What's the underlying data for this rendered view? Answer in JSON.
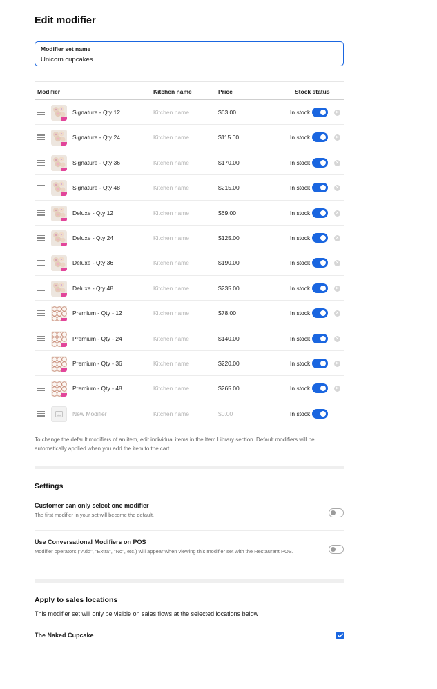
{
  "page": {
    "title": "Edit modifier"
  },
  "name_field": {
    "label": "Modifier set name",
    "value": "Unicorn cupcakes"
  },
  "table": {
    "headers": {
      "modifier": "Modifier",
      "kitchen": "Kitchen name",
      "price": "Price",
      "stock": "Stock status"
    },
    "kitchen_placeholder": "Kitchen name",
    "rows": [
      {
        "name": "Signature - Qty 12",
        "price": "$63.00",
        "stock": "In stock",
        "image": "cupcake-photo"
      },
      {
        "name": "Signature - Qty 24",
        "price": "$115.00",
        "stock": "In stock",
        "image": "cupcake-photo"
      },
      {
        "name": "Signature - Qty 36",
        "price": "$170.00",
        "stock": "In stock",
        "image": "cupcake-photo"
      },
      {
        "name": "Signature - Qty 48",
        "price": "$215.00",
        "stock": "In stock",
        "image": "cupcake-photo"
      },
      {
        "name": "Deluxe - Qty 12",
        "price": "$69.00",
        "stock": "In stock",
        "image": "cupcake-photo"
      },
      {
        "name": "Deluxe - Qty 24",
        "price": "$125.00",
        "stock": "In stock",
        "image": "cupcake-photo"
      },
      {
        "name": "Deluxe - Qty 36",
        "price": "$190.00",
        "stock": "In stock",
        "image": "cupcake-photo"
      },
      {
        "name": "Deluxe - Qty 48",
        "price": "$235.00",
        "stock": "In stock",
        "image": "cupcake-photo"
      },
      {
        "name": "Premium - Qty - 12",
        "price": "$78.00",
        "stock": "In stock",
        "image": "cupcake-box-photo"
      },
      {
        "name": "Premium - Qty - 24",
        "price": "$140.00",
        "stock": "In stock",
        "image": "cupcake-box-photo"
      },
      {
        "name": "Premium - Qty - 36",
        "price": "$220.00",
        "stock": "In stock",
        "image": "cupcake-box-photo"
      },
      {
        "name": "Premium - Qty - 48",
        "price": "$265.00",
        "stock": "In stock",
        "image": "cupcake-box-photo"
      }
    ],
    "new_row": {
      "name_placeholder": "New Modifier",
      "price_placeholder": "$0.00",
      "stock": "In stock"
    }
  },
  "note": "To change the default modifiers of an item, edit individual items in the Item Library section. Default modifiers will be automatically applied when you add the item to the cart.",
  "settings": {
    "title": "Settings",
    "single_select": {
      "title": "Customer can only select one modifier",
      "description": "The first modifier in your set will become the default.",
      "enabled": false
    },
    "conversational": {
      "title": "Use Conversational Modifiers on POS",
      "description": "Modifier operators (\"Add\", \"Extra\", \"No\", etc.) will appear when viewing this modifier set with the Restaurant POS.",
      "enabled": false
    }
  },
  "locations": {
    "title": "Apply to sales locations",
    "description": "This modifier set will only be visible on sales flows at the selected locations below",
    "items": [
      {
        "name": "The Naked Cupcake",
        "checked": true
      }
    ]
  },
  "colors": {
    "accent": "#1a66e0",
    "divider": "#efefef"
  }
}
